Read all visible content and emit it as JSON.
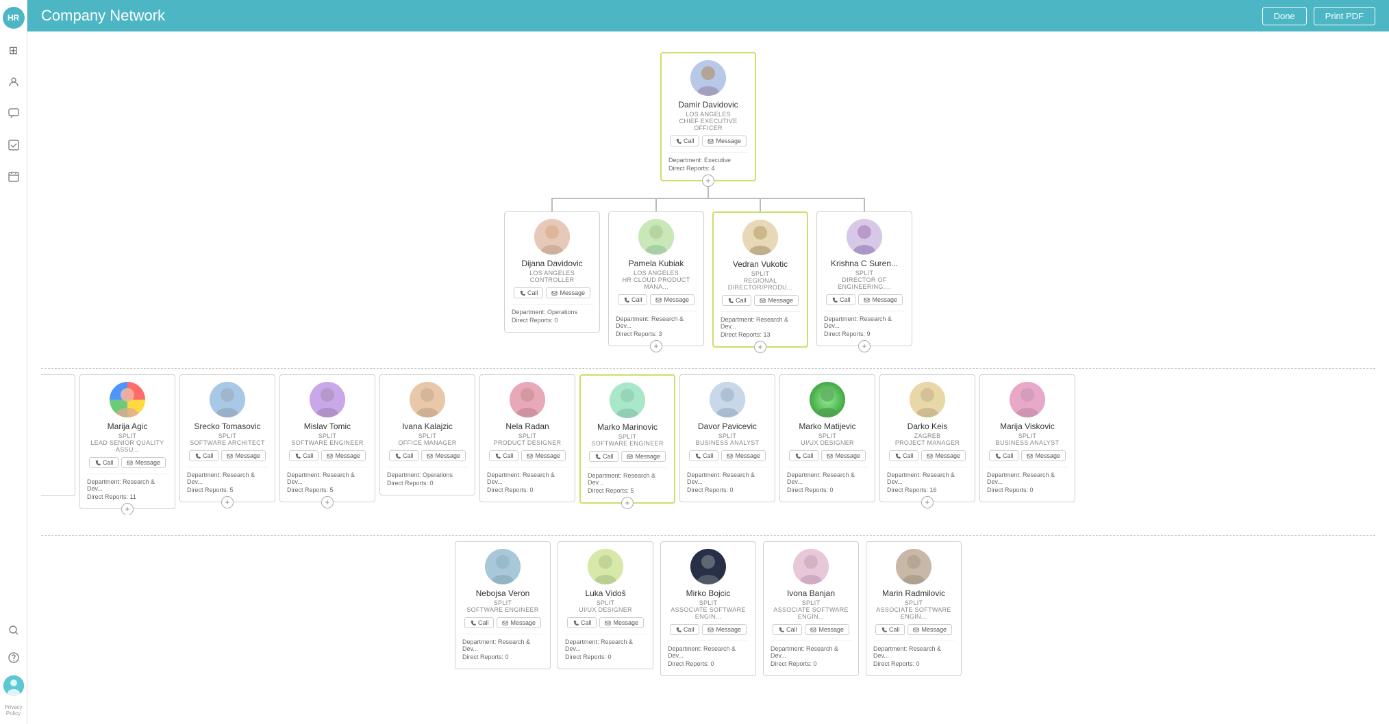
{
  "header": {
    "title": "Company Network",
    "done_label": "Done",
    "print_label": "Print PDF",
    "logo": "HR"
  },
  "sidebar": {
    "icons": [
      {
        "name": "grid-icon",
        "symbol": "⊞",
        "active": false
      },
      {
        "name": "person-icon",
        "symbol": "👤",
        "active": false
      },
      {
        "name": "chat-icon",
        "symbol": "💬",
        "active": false
      },
      {
        "name": "check-icon",
        "symbol": "☑",
        "active": false
      },
      {
        "name": "calendar-icon",
        "symbol": "📅",
        "active": false
      }
    ],
    "bottom": [
      {
        "name": "search-icon",
        "symbol": "🔍"
      },
      {
        "name": "help-icon",
        "symbol": "?"
      }
    ],
    "avatar_initials": "HR",
    "privacy_label": "Privacy\nPolicy"
  },
  "ceo": {
    "name": "Damir Davidovic",
    "location": "LOS ANGELES",
    "title": "CHIEF EXECUTIVE OFFICER",
    "call_label": "Call",
    "message_label": "Message",
    "department": "Executive",
    "direct_reports": "4",
    "highlighted": true
  },
  "level1": [
    {
      "name": "Dijana Davidovic",
      "location": "LOS ANGELES",
      "title": "CONTROLLER",
      "department": "Operations",
      "direct_reports": "0",
      "highlighted": false,
      "av_class": "av-dijana"
    },
    {
      "name": "Pamela Kubiak",
      "location": "LOS ANGELES",
      "title": "HR CLOUD PRODUCT MANA...",
      "department": "Research & Dev...",
      "direct_reports": "3",
      "highlighted": false,
      "av_class": "av-pamela"
    },
    {
      "name": "Vedran Vukotic",
      "location": "SPLIT",
      "title": "REGIONAL DIRECTOR/PRODU...",
      "department": "Research & Dev...",
      "direct_reports": "13",
      "highlighted": true,
      "av_class": "av-vedran"
    },
    {
      "name": "Krishna C Suren...",
      "location": "SPLIT",
      "title": "DIRECTOR OF ENGINEERING,...",
      "department": "Research & Dev...",
      "direct_reports": "9",
      "highlighted": false,
      "av_class": "av-krishna"
    }
  ],
  "level2": [
    {
      "name": "Marija Agic",
      "location": "SPLIT",
      "title": "LEAD SENIOR QUALITY ASSU...",
      "department": "Research & Dev...",
      "direct_reports": "11",
      "highlighted": false,
      "av_class": "av-marija-a",
      "partial_left": true
    },
    {
      "name": "Srecko Tomasovic",
      "location": "SPLIT",
      "title": "SOFTWARE ARCHITECT",
      "department": "Research & Dev...",
      "direct_reports": "5",
      "highlighted": false,
      "av_class": "av-srecko"
    },
    {
      "name": "Mislav Tomic",
      "location": "SPLIT",
      "title": "SOFTWARE ENGINEER",
      "department": "Research & Dev...",
      "direct_reports": "5",
      "highlighted": false,
      "av_class": "av-mislav"
    },
    {
      "name": "Ivana Kalajzic",
      "location": "SPLIT",
      "title": "OFFICE MANAGER",
      "department": "Operations",
      "direct_reports": "0",
      "highlighted": false,
      "av_class": "av-ivana"
    },
    {
      "name": "Nela Radan",
      "location": "SPLIT",
      "title": "PRODUCT DESIGNER",
      "department": "Research & Dev...",
      "direct_reports": "0",
      "highlighted": false,
      "av_class": "av-nela"
    },
    {
      "name": "Marko Marinovic",
      "location": "SPLIT",
      "title": "SOFTWARE ENGINEER",
      "department": "Research & Dev...",
      "direct_reports": "5",
      "highlighted": true,
      "av_class": "av-marko"
    },
    {
      "name": "Davor Pavicevic",
      "location": "SPLIT",
      "title": "BUSINESS ANALYST",
      "department": "Research & Dev...",
      "direct_reports": "0",
      "highlighted": false,
      "av_class": "av-davor"
    },
    {
      "name": "Marko Matijevic",
      "location": "SPLIT",
      "title": "UI/UX DESIGNER",
      "department": "Research & Dev...",
      "direct_reports": "0",
      "highlighted": false,
      "av_class": "av-marko-m"
    },
    {
      "name": "Darko Keis",
      "location": "ZAGREB",
      "title": "PROJECT MANAGER",
      "department": "Research & Dev...",
      "direct_reports": "16",
      "highlighted": false,
      "av_class": "av-darko"
    },
    {
      "name": "Marija Viskovic",
      "location": "SPLIT",
      "title": "BUSINESS ANALYST",
      "department": "Research & Dev...",
      "direct_reports": "0",
      "highlighted": false,
      "av_class": "av-marija-v",
      "partial_right": true
    }
  ],
  "level3": [
    {
      "name": "Nebojsa Veron",
      "location": "SPLIT",
      "title": "SOFTWARE ENGINEER",
      "department": "Research & Dev...",
      "direct_reports": "0",
      "highlighted": false,
      "av_class": "av-nebojsa"
    },
    {
      "name": "Luka Vidoš",
      "location": "SPLIT",
      "title": "UI/UX DESIGNER",
      "department": "Research & Dev...",
      "direct_reports": "0",
      "highlighted": false,
      "av_class": "av-luka"
    },
    {
      "name": "Mirko Bojcic",
      "location": "SPLIT",
      "title": "ASSOCIATE SOFTWARE ENGIN...",
      "department": "Research & Dev...",
      "direct_reports": "0",
      "highlighted": false,
      "av_class": "av-mirko"
    },
    {
      "name": "Ivona Banjan",
      "location": "SPLIT",
      "title": "ASSOCIATE SOFTWARE ENGIN...",
      "department": "Research & Dev...",
      "direct_reports": "0",
      "highlighted": false,
      "av_class": "av-ivona"
    },
    {
      "name": "Marin Radmilovic",
      "location": "SPLIT",
      "title": "ASSOCIATE SOFTWARE ENGIN...",
      "department": "Research & Dev...",
      "direct_reports": "0",
      "highlighted": false,
      "av_class": "av-marin"
    }
  ],
  "labels": {
    "call": "Call",
    "message": "Message",
    "department_prefix": "Department:",
    "direct_reports_prefix": "Direct Reports:"
  }
}
